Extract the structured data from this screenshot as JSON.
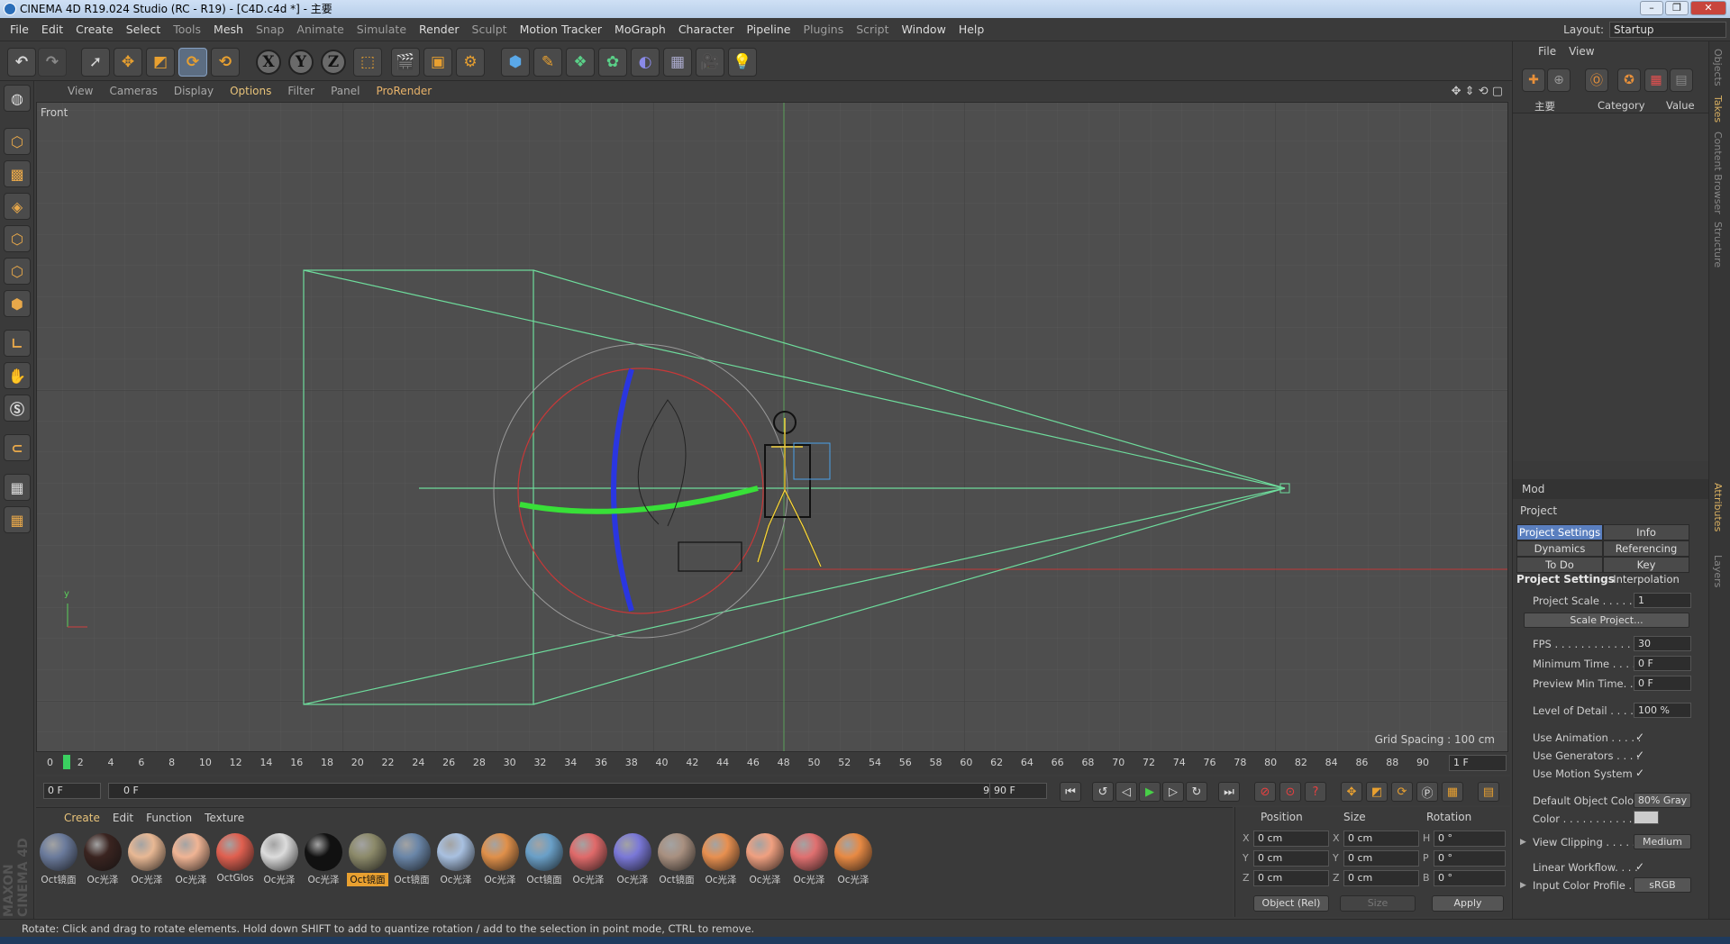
{
  "window": {
    "title": "CINEMA 4D R19.024 Studio (RC - R19) - [C4D.c4d *] - 主要"
  },
  "menu": [
    "File",
    "Edit",
    "Create",
    "Select",
    "Tools",
    "Mesh",
    "Snap",
    "Animate",
    "Simulate",
    "Sculpt",
    "Render",
    "Sculpt",
    "Motion Tracker",
    "MoGraph",
    "Character",
    "Pipeline",
    "Plugins",
    "Script",
    "Window",
    "Help"
  ],
  "layout": {
    "label": "Layout:",
    "value": "Startup"
  },
  "toolbar": {
    "axis_x": "X",
    "axis_y": "Y",
    "axis_z": "Z"
  },
  "viewport": {
    "menu": [
      "View",
      "Cameras",
      "Display",
      "Options",
      "Filter",
      "Panel",
      "ProRender"
    ],
    "name": "Front",
    "grid_spacing": "Grid Spacing : 100 cm"
  },
  "timeline": {
    "ticks": [
      "0",
      "2",
      "4",
      "6",
      "8",
      "10",
      "12",
      "14",
      "16",
      "18",
      "20",
      "22",
      "24",
      "26",
      "28",
      "30",
      "32",
      "34",
      "36",
      "38",
      "40",
      "42",
      "44",
      "46",
      "48",
      "50",
      "52",
      "54",
      "56",
      "58",
      "60",
      "62",
      "64",
      "66",
      "68",
      "70",
      "72",
      "74",
      "76",
      "78",
      "80",
      "82",
      "84",
      "86",
      "88",
      "90"
    ],
    "end_frame": "1 F",
    "current": "0 F",
    "range_start": "0 F",
    "range_end": "90 F",
    "max": "90 F"
  },
  "materials": {
    "menu": [
      "Create",
      "Edit",
      "Function",
      "Texture"
    ],
    "items": [
      {
        "label": "Oct镜面",
        "color": "#6b7b9c"
      },
      {
        "label": "Oc光泽",
        "color": "#3a2420"
      },
      {
        "label": "Oc光泽",
        "color": "#e8b894"
      },
      {
        "label": "Oc光泽",
        "color": "#f0b494"
      },
      {
        "label": "OctGlos",
        "color": "#e06050"
      },
      {
        "label": "Oc光泽",
        "color": "#dcdcdc"
      },
      {
        "label": "Oc光泽",
        "color": "#111111"
      },
      {
        "label": "Oct镜面",
        "color": "#8c8a6a"
      },
      {
        "label": "Oct镜面",
        "color": "#6a86a8"
      },
      {
        "label": "Oc光泽",
        "color": "#a8c0e0"
      },
      {
        "label": "Oc光泽",
        "color": "#e0904a"
      },
      {
        "label": "Oct镜面",
        "color": "#6aa0c8"
      },
      {
        "label": "Oc光泽",
        "color": "#e06a6a"
      },
      {
        "label": "Oc光泽",
        "color": "#7a78d8"
      },
      {
        "label": "Oct镜面",
        "color": "#a89080"
      },
      {
        "label": "Oc光泽",
        "color": "#e89050"
      },
      {
        "label": "Oc光泽",
        "color": "#f0a080"
      },
      {
        "label": "Oc光泽",
        "color": "#e07070"
      },
      {
        "label": "Oc光泽",
        "color": "#e88a44"
      }
    ],
    "selected_index": 7
  },
  "coords": {
    "headers": [
      "Position",
      "Size",
      "Rotation"
    ],
    "rows": [
      {
        "axis": "X",
        "pos": "0 cm",
        "saxis": "X",
        "size": "0 cm",
        "raxis": "H",
        "rot": "0 °"
      },
      {
        "axis": "Y",
        "pos": "0 cm",
        "saxis": "Y",
        "size": "0 cm",
        "raxis": "P",
        "rot": "0 °"
      },
      {
        "axis": "Z",
        "pos": "0 cm",
        "saxis": "Z",
        "size": "0 cm",
        "raxis": "B",
        "rot": "0 °"
      }
    ],
    "mode": "Object (Rel)",
    "size_mode": "Size",
    "apply": "Apply"
  },
  "objects": {
    "menu": [
      "File",
      "View"
    ],
    "root": "主要",
    "col_category": "Category",
    "col_value": "Value"
  },
  "attributes": {
    "mode": "Mod",
    "title": "Project",
    "tabs": [
      "Project Settings",
      "Info",
      "Dynamics",
      "Referencing",
      "To Do",
      "Key Interpolation"
    ],
    "section": "Project Settings",
    "project_scale_label": "Project Scale . . . . . .",
    "project_scale": "1",
    "scale_project_btn": "Scale Project...",
    "fps_label": "FPS . . . . . . . . . . . . . . .",
    "fps": "30",
    "min_time_label": "Minimum Time . . . .",
    "min_time": "0 F",
    "preview_min_label": "Preview Min Time. .",
    "preview_min": "0 F",
    "lod_label": "Level of Detail . . . . .",
    "lod": "100 %",
    "use_anim": "Use Animation . . . . .",
    "use_gen": "Use Generators . . . .",
    "use_motion": "Use Motion System",
    "check": "✓",
    "def_color_label": "Default Object Color",
    "def_color": "80% Gray",
    "color_label": "Color . . . . . . . . . . .",
    "clipping_label": "View Clipping . . . . .",
    "clipping": "Medium",
    "linear_label": "Linear Workflow. . . .",
    "input_cp_label": "Input Color Profile . .",
    "input_cp": "sRGB"
  },
  "side_tabs": [
    "Objects",
    "Takes",
    "Content Browser",
    "Structure",
    "Attributes",
    "Layers"
  ],
  "status": "Rotate: Click and drag to rotate elements. Hold down SHIFT to add to quantize rotation / add to the selection in point mode, CTRL to remove.",
  "brand": "MAXON CINEMA 4D"
}
